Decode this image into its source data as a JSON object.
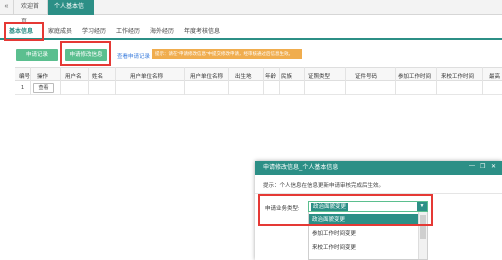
{
  "titlebar": {
    "tabs": [
      {
        "label": "欢迎首页"
      },
      {
        "label": "个人基本信息",
        "close": "×"
      }
    ],
    "nav_icon": "«"
  },
  "subtabs": [
    {
      "label": "基本信息",
      "active": true
    },
    {
      "label": "家庭成员"
    },
    {
      "label": "学习经历"
    },
    {
      "label": "工作经历"
    },
    {
      "label": "海外经历"
    },
    {
      "label": "年度考核信息"
    }
  ],
  "toolbar": {
    "btn_apply_record": "申请记录",
    "btn_apply_change": "申请修改信息",
    "link_view_records": "查看申请记录",
    "hint": "提示：请在“申请修改信息”中提交修改申请，经审核通过后信息生效。"
  },
  "table": {
    "headers": [
      "编号",
      "操作",
      "用户名",
      "姓名",
      "用户单位名称",
      "用户单位名称",
      "出生地",
      "年龄",
      "民族",
      "证照类型",
      "证件号码",
      "参加工作时间",
      "来校工作时间",
      "最高"
    ],
    "rows": [
      {
        "no": "1",
        "action": "查看"
      }
    ]
  },
  "modal": {
    "title": "申请修改信息_个人基本信息",
    "ctrl_min": "—",
    "ctrl_max": "❐",
    "ctrl_close": "✕",
    "tip": "提示：个人信息在信息更新申请审核完成后生效。",
    "field_label": "申请业务类型:",
    "select_value": "政治面貌变更",
    "options": [
      "政治面貌变更",
      "参加工作时间变更",
      "来校工作时间变更"
    ]
  },
  "colors": {
    "accent": "#2c8f86",
    "button_green": "#5bbf8f",
    "highlight_red": "#e53935",
    "hint_orange": "#f0ad4e",
    "link_blue": "#3b7ddd"
  }
}
